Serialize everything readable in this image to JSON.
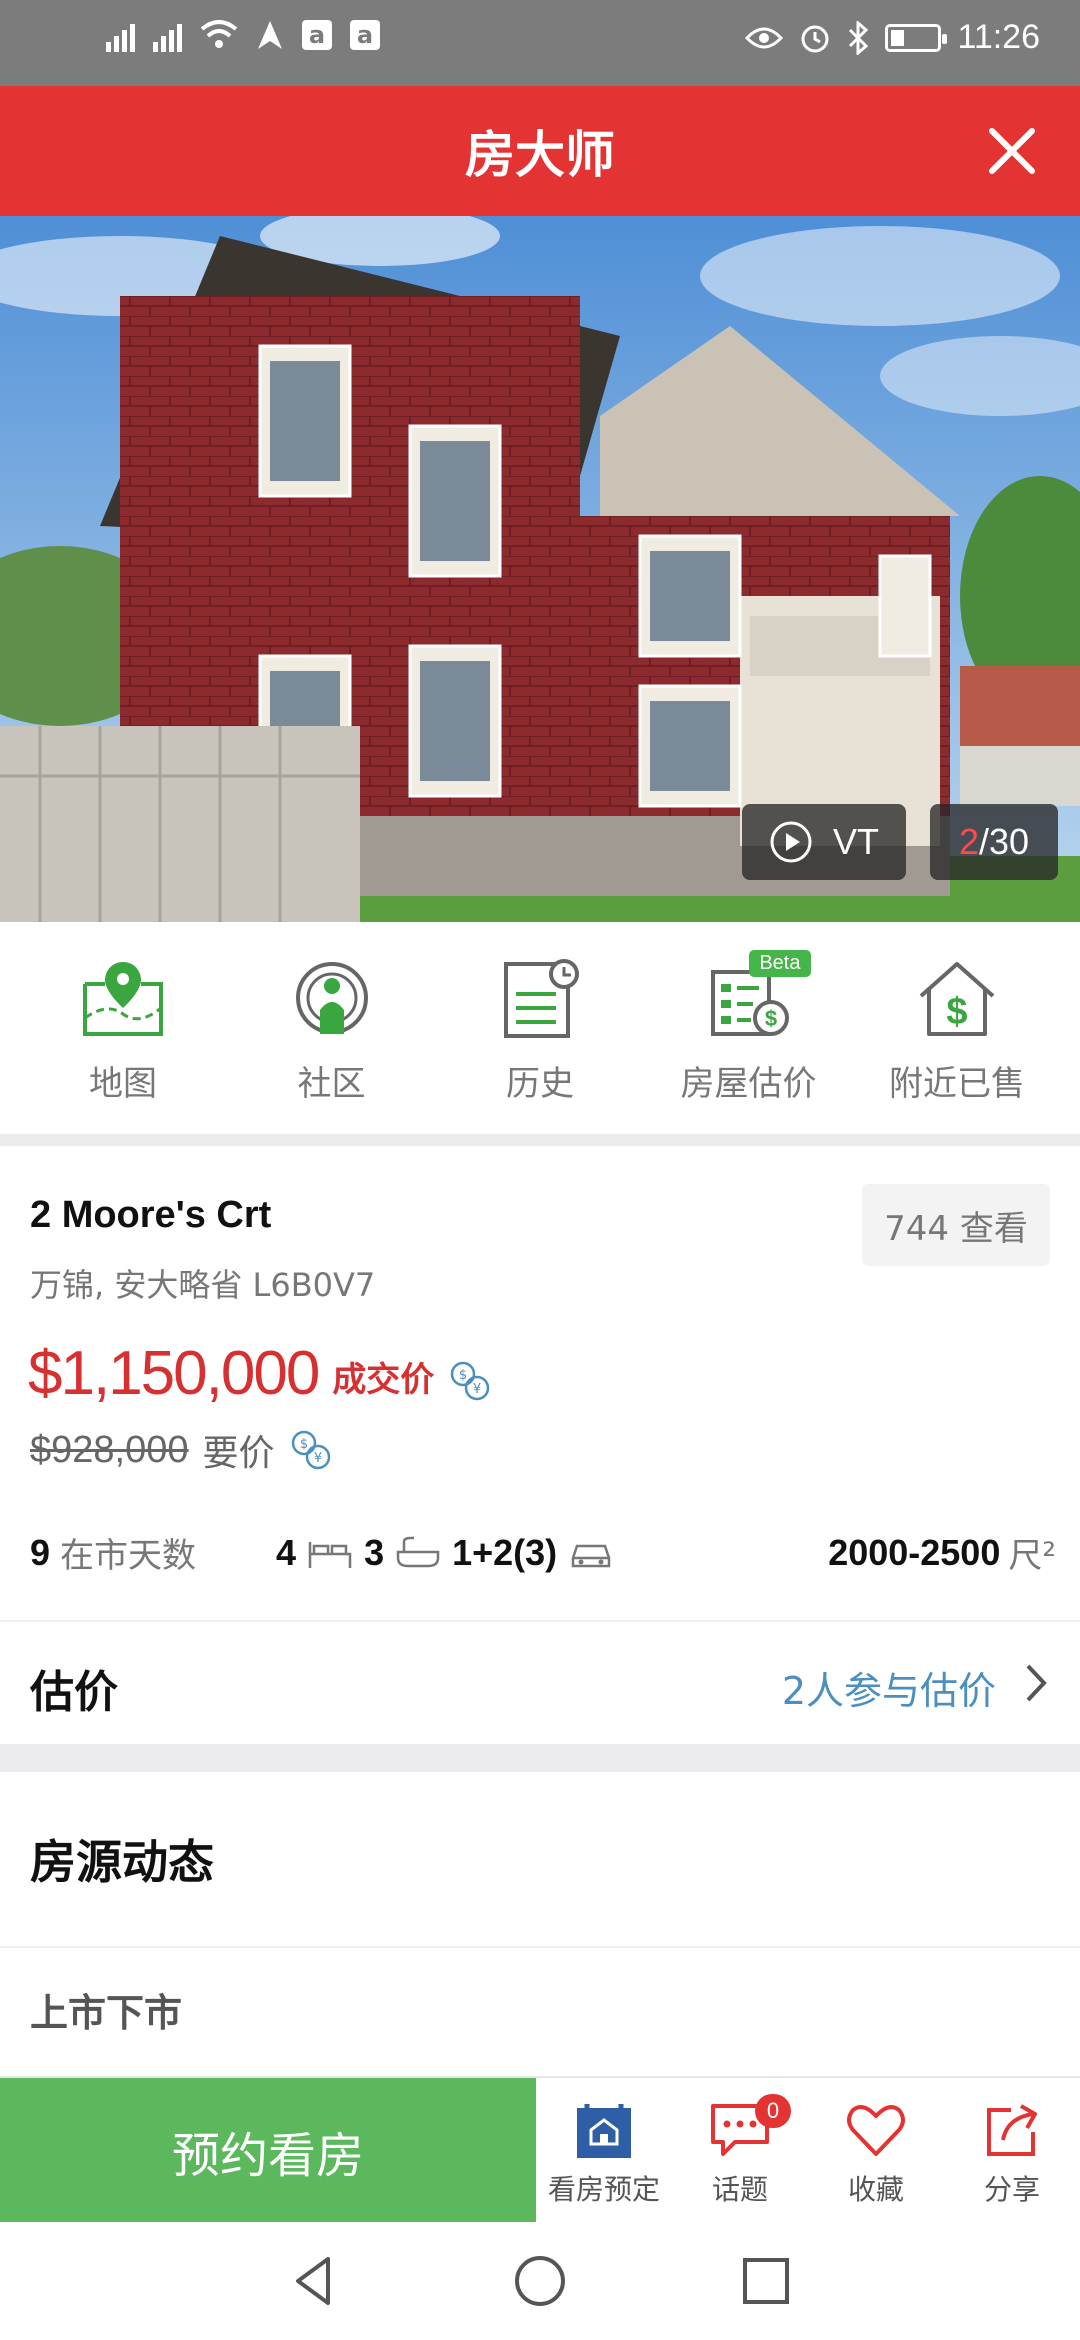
{
  "status_bar": {
    "time": "11:26",
    "icons": [
      "signal-icon",
      "signal-icon",
      "wifi-icon",
      "location-arrow-icon",
      "app-a-icon",
      "app-a-icon",
      "eye-icon",
      "alarm-icon",
      "bluetooth-icon",
      "battery-icon"
    ],
    "app_box_letter": "a",
    "battery_level": 0.26
  },
  "header": {
    "title": "房大师",
    "close_icon": "close-icon"
  },
  "hero": {
    "vt_label": "VT",
    "photo_current": "2",
    "photo_total": "/30"
  },
  "actions": [
    {
      "label": "地图",
      "icon": "map-pin-icon"
    },
    {
      "label": "社区",
      "icon": "community-icon"
    },
    {
      "label": "历史",
      "icon": "history-icon"
    },
    {
      "label": "房屋估价",
      "icon": "valuation-icon",
      "badge": "Beta"
    },
    {
      "label": "附近已售",
      "icon": "house-dollar-icon"
    }
  ],
  "listing": {
    "address": "2 Moore's Crt",
    "city": "万锦, 安大略省 L6B0V7",
    "views": "744 查看",
    "sold_price": "$1,150,000",
    "sold_label": "成交价",
    "asking_price": "$928,000",
    "asking_label": "要价",
    "days_on_market": "9",
    "days_label": "在市天数",
    "bedrooms": "4",
    "bathrooms": "3",
    "parking": "1+2(3)",
    "area": "2000-2500",
    "area_unit": "尺²"
  },
  "estimate": {
    "title": "估价",
    "link": "2人参与估价"
  },
  "sections": {
    "activity_title": "房源动态",
    "activity_sub": "上市下市"
  },
  "bottom": {
    "book_label": "预约看房",
    "tabs": [
      {
        "label": "看房预定",
        "icon": "booking-icon"
      },
      {
        "label": "话题",
        "icon": "chat-icon",
        "badge": "0"
      },
      {
        "label": "收藏",
        "icon": "heart-icon"
      },
      {
        "label": "分享",
        "icon": "share-icon"
      }
    ]
  },
  "colors": {
    "brand_red": "#e33333",
    "green": "#5bb85c",
    "icon_green": "#3aa63f",
    "link_blue": "#4a8fbf",
    "price_red": "#d63031"
  }
}
